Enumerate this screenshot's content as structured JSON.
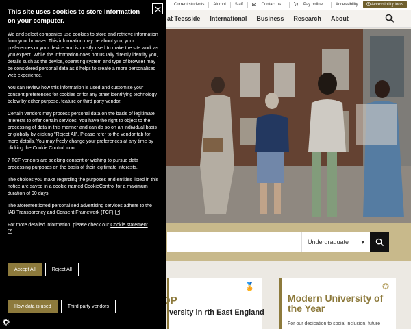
{
  "topbar": {
    "links": [
      "Current students",
      "Alumni",
      "Staff",
      "Contact us",
      "Pay online",
      "Accessibility"
    ],
    "accessibility_tools": "Accessibility tools"
  },
  "nav": {
    "items": [
      "at Teesside",
      "International",
      "Business",
      "Research",
      "About"
    ]
  },
  "search": {
    "placeholder": "",
    "level_selected": "Undergraduate"
  },
  "cards": {
    "card1": {
      "title": "OP",
      "text": "versity in rth East England"
    },
    "card2": {
      "title": "Modern University of the Year",
      "text": "For our dedication to social inclusion, future"
    }
  },
  "cookie": {
    "title": "This site uses cookies to store information on your computer.",
    "p1": "We and select companies use cookies to store and retrieve information from your browser. This information may be about you, your preferences or your device and is mostly used to make the site work as you expect. While the information does not usually directly identify you, details such as the device, operating system and type of browser may be considered personal data as it helps to create a more personalised web experience.",
    "p2": "You can review how this information is used and customise your consent preferences for cookies or for any other identifying technology below by either purpose, feature or third party vendor.",
    "p3": "Certain vendors may process personal data on the basis of legitimate interests to offer certain services. You have the right to object to the processing of data in this manner and can do so on an individual basis or globally by clicking \"Reject All\". Please refer to the vendor tab for more details. You may freely change your preferences at any time by clicking the Cookie Control icon.",
    "p4": "7 TCF vendors are seeking consent or wishing to pursue data processing purposes on the basis of their legitimate interests.",
    "p5": "The choices you make regarding the purposes and entities listed in this notice are saved in a cookie named CookieControl for a maximum duration of 90 days.",
    "p6_prefix": "The aforementioned personalised advertising services adhere to the ",
    "p6_link": "IAB Transparency and Consent Framework (TCF)",
    "p7_prefix": "For more detailed information, please check our ",
    "p7_link": "Cookie statement",
    "accept_all": "Accept All",
    "reject_all": "Reject All",
    "how_data_used": "How data is used",
    "third_party": "Third party vendors"
  },
  "colors": {
    "gold": "#8d7a3c",
    "band": "#c8b98b",
    "panel": "#000000"
  }
}
